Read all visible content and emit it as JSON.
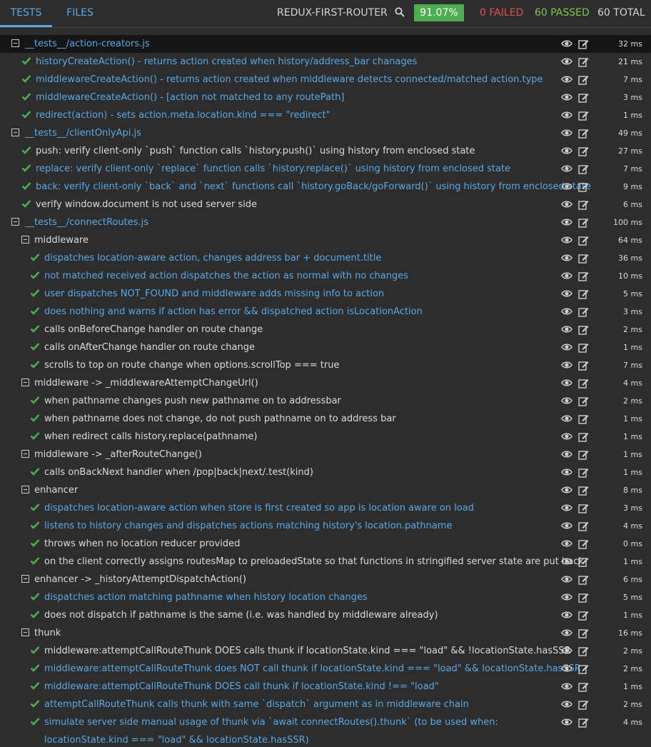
{
  "tabs": {
    "tests": "TESTS",
    "files": "FILES"
  },
  "header": {
    "project": "REDUX-FIRST-ROUTER",
    "coverage": "91.07%",
    "failed": "0 FAILED",
    "passed": "60 PASSED",
    "total": "60 TOTAL"
  },
  "colors": {
    "accent": "#5aa9e6",
    "pass": "#4cae4f",
    "fail": "#e05252",
    "coverage_bg": "#4cae4f"
  },
  "rows": [
    {
      "kind": "file",
      "level": 0,
      "label": "__tests__/action-creators.js",
      "time": "32 ms",
      "dark": true
    },
    {
      "kind": "test",
      "level": 1,
      "label": "historyCreateAction() - returns action created when history/address_bar chanages",
      "time": "21 ms",
      "blue": true
    },
    {
      "kind": "test",
      "level": 1,
      "label": "middlewareCreateAction() - returns action created when middleware detects connected/matched action.type",
      "time": "7 ms",
      "blue": true
    },
    {
      "kind": "test",
      "level": 1,
      "label": "middlewareCreateAction() - [action not matched to any routePath]",
      "time": "3 ms",
      "blue": true
    },
    {
      "kind": "test",
      "level": 1,
      "label": "redirect(action) - sets action.meta.location.kind === \"redirect\"",
      "time": "1 ms",
      "blue": true
    },
    {
      "kind": "file",
      "level": 0,
      "label": "__tests__/clientOnlyApi.js",
      "time": "49 ms"
    },
    {
      "kind": "test",
      "level": 1,
      "label": "push: verify client-only `push` function calls `history.push()` using history from enclosed state",
      "time": "27 ms"
    },
    {
      "kind": "test",
      "level": 1,
      "label": "replace: verify client-only `replace` function calls `history.replace()` using history from enclosed state",
      "time": "7 ms",
      "blue": true
    },
    {
      "kind": "test",
      "level": 1,
      "label": "back: verify client-only `back` and `next` functions call `history.goBack/goForward()` using history from enclosed state",
      "time": "9 ms",
      "blue": true
    },
    {
      "kind": "test",
      "level": 1,
      "label": "verify window.document is not used server side",
      "time": "6 ms"
    },
    {
      "kind": "file",
      "level": 0,
      "label": "__tests__/connectRoutes.js",
      "time": "100 ms"
    },
    {
      "kind": "group",
      "level": 1,
      "label": "middleware",
      "time": "64 ms"
    },
    {
      "kind": "test",
      "level": 2,
      "label": "dispatches location-aware action, changes address bar + document.title",
      "time": "36 ms",
      "blue": true
    },
    {
      "kind": "test",
      "level": 2,
      "label": "not matched received action dispatches the action as normal with no changes",
      "time": "10 ms",
      "blue": true
    },
    {
      "kind": "test",
      "level": 2,
      "label": "user dispatches NOT_FOUND and middleware adds missing info to action",
      "time": "5 ms",
      "blue": true
    },
    {
      "kind": "test",
      "level": 2,
      "label": "does nothing and warns if action has error && dispatched action isLocationAction",
      "time": "3 ms",
      "blue": true
    },
    {
      "kind": "test",
      "level": 2,
      "label": "calls onBeforeChange handler on route change",
      "time": "2 ms"
    },
    {
      "kind": "test",
      "level": 2,
      "label": "calls onAfterChange handler on route change",
      "time": "1 ms"
    },
    {
      "kind": "test",
      "level": 2,
      "label": "scrolls to top on route change when options.scrollTop === true",
      "time": "7 ms"
    },
    {
      "kind": "group",
      "level": 1,
      "label": "middleware -> _middlewareAttemptChangeUrl()",
      "time": "4 ms"
    },
    {
      "kind": "test",
      "level": 2,
      "label": "when pathname changes push new pathname on to addressbar",
      "time": "2 ms"
    },
    {
      "kind": "test",
      "level": 2,
      "label": "when pathname does not change, do not push pathname on to address bar",
      "time": "1 ms"
    },
    {
      "kind": "test",
      "level": 2,
      "label": "when redirect calls history.replace(pathname)",
      "time": "1 ms"
    },
    {
      "kind": "group",
      "level": 1,
      "label": "middleware -> _afterRouteChange()",
      "time": "1 ms"
    },
    {
      "kind": "test",
      "level": 2,
      "label": "calls onBackNext handler when /pop|back|next/.test(kind)",
      "time": "1 ms"
    },
    {
      "kind": "group",
      "level": 1,
      "label": "enhancer",
      "time": "8 ms"
    },
    {
      "kind": "test",
      "level": 2,
      "label": "dispatches location-aware action when store is first created so app is location aware on load",
      "time": "3 ms",
      "blue": true
    },
    {
      "kind": "test",
      "level": 2,
      "label": "listens to history changes and dispatches actions matching history's location.pathname",
      "time": "4 ms",
      "blue": true
    },
    {
      "kind": "test",
      "level": 2,
      "label": "throws when no location reducer provided",
      "time": "0 ms"
    },
    {
      "kind": "test",
      "level": 2,
      "label": "on the client correctly assigns routesMap to preloadedState so that functions in stringified server state are put back",
      "time": "1 ms"
    },
    {
      "kind": "group",
      "level": 1,
      "label": "enhancer -> _historyAttemptDispatchAction()",
      "time": "6 ms"
    },
    {
      "kind": "test",
      "level": 2,
      "label": "dispatches action matching pathname when history location changes",
      "time": "5 ms",
      "blue": true
    },
    {
      "kind": "test",
      "level": 2,
      "label": "does not dispatch if pathname is the same (i.e. was handled by middleware already)",
      "time": "1 ms"
    },
    {
      "kind": "group",
      "level": 1,
      "label": "thunk",
      "time": "16 ms"
    },
    {
      "kind": "test",
      "level": 2,
      "label": "middleware:attemptCallRouteThunk DOES calls thunk if locationState.kind === \"load\" && !locationState.hasSSR",
      "time": "2 ms"
    },
    {
      "kind": "test",
      "level": 2,
      "label": "middleware:attemptCallRouteThunk does NOT call thunk if locationState.kind === \"load\" && locationState.hasSSR",
      "time": "2 ms",
      "blue": true
    },
    {
      "kind": "test",
      "level": 2,
      "label": "middleware:attemptCallRouteThunk DOES call thunk if locationState.kind !== \"load\"",
      "time": "1 ms",
      "blue": true
    },
    {
      "kind": "test",
      "level": 2,
      "label": "attemptCallRouteThunk calls thunk with same `dispatch` argument as in middleware chain",
      "time": "2 ms",
      "blue": true
    },
    {
      "kind": "test",
      "level": 2,
      "label": "simulate server side manual usage of thunk via `await connectRoutes().thunk` (to be used when: locationState.kind === \"load\" && locationState.hasSSR)",
      "time": "4 ms",
      "blue": true,
      "wrap": true
    }
  ]
}
